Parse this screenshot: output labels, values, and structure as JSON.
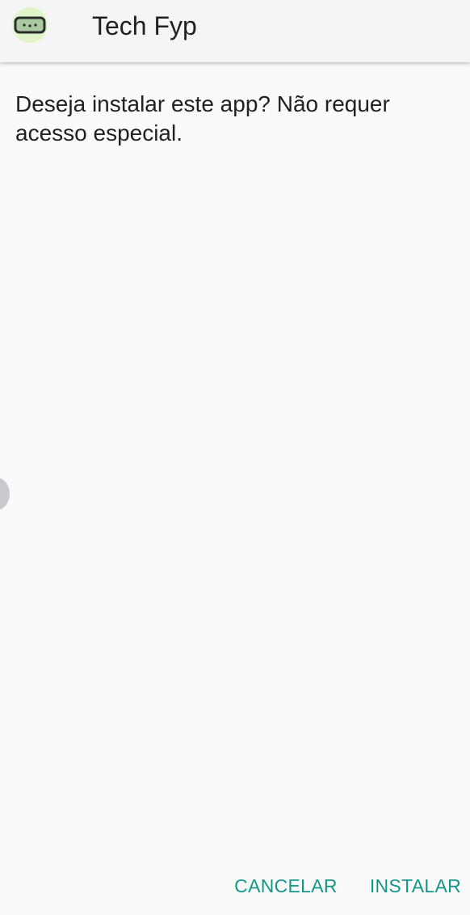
{
  "header": {
    "icon": "installer-app-icon",
    "title": "Tech Fyp"
  },
  "dialog": {
    "message": "Deseja instalar este app? Não requer acesso especial.",
    "cancel_label": "CANCELAR",
    "install_label": "INSTALAR"
  },
  "colors": {
    "accent": "#159688",
    "background": "#fafafa",
    "app_bar": "#f5f5f5",
    "text": "#212121",
    "icon_bg": "#dff5c9"
  }
}
